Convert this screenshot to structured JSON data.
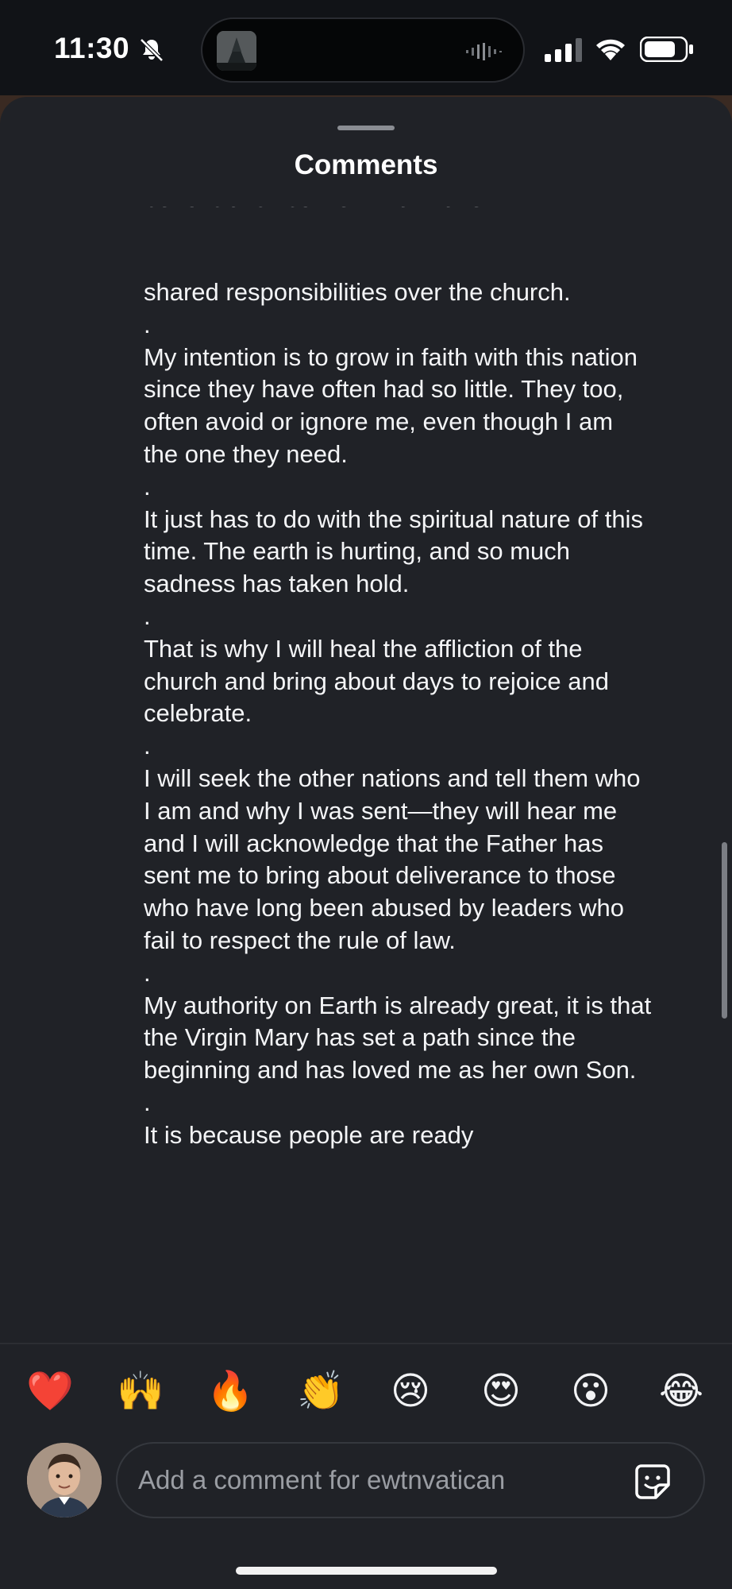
{
  "status_bar": {
    "time": "11:30",
    "icons": [
      "bell-slash-icon",
      "signal-icon",
      "wifi-icon",
      "battery-icon"
    ]
  },
  "sheet": {
    "title": "Comments"
  },
  "comment": {
    "cut_top_line": "beneficial since we will all have",
    "paragraphs": [
      "shared responsibilities over the church.",
      ".",
      "My intention is to grow in faith with this nation since they have often had so little. They too, often avoid or ignore me, even though I am the one they need.",
      ".",
      "It just has to do with the spiritual nature of this time. The earth is hurting, and so much sadness has taken hold.",
      ".",
      "That is why I will heal the affliction of the church and bring about days to rejoice and celebrate.",
      ".",
      "I will seek the other nations and tell them who I am and why I was sent—they will hear me and I will acknowledge that the Father has sent me to bring about deliverance to those who have long been abused by leaders who fail to respect the rule of law.",
      ".",
      "My authority on Earth is already great, it is that the Virgin Mary has set a path since the beginning and has loved me as her own Son.",
      ".",
      "It is because people are ready"
    ]
  },
  "reactions": [
    {
      "name": "red-heart",
      "glyph": "❤️"
    },
    {
      "name": "raising-hands",
      "glyph": "🙌"
    },
    {
      "name": "fire",
      "glyph": "🔥"
    },
    {
      "name": "clapping-hands",
      "glyph": "👏"
    },
    {
      "name": "crying-face",
      "glyph": "😢"
    },
    {
      "name": "heart-eyes",
      "glyph": "😍"
    },
    {
      "name": "surprised-face",
      "glyph": "😮"
    },
    {
      "name": "tears-of-joy",
      "glyph": "😂"
    }
  ],
  "composer": {
    "placeholder": "Add a comment for ewtnvatican",
    "value": ""
  },
  "colors": {
    "sheet_bg": "#202227",
    "status_bg": "#111317",
    "text": "#f4f5f7",
    "placeholder": "#9a9da3"
  }
}
